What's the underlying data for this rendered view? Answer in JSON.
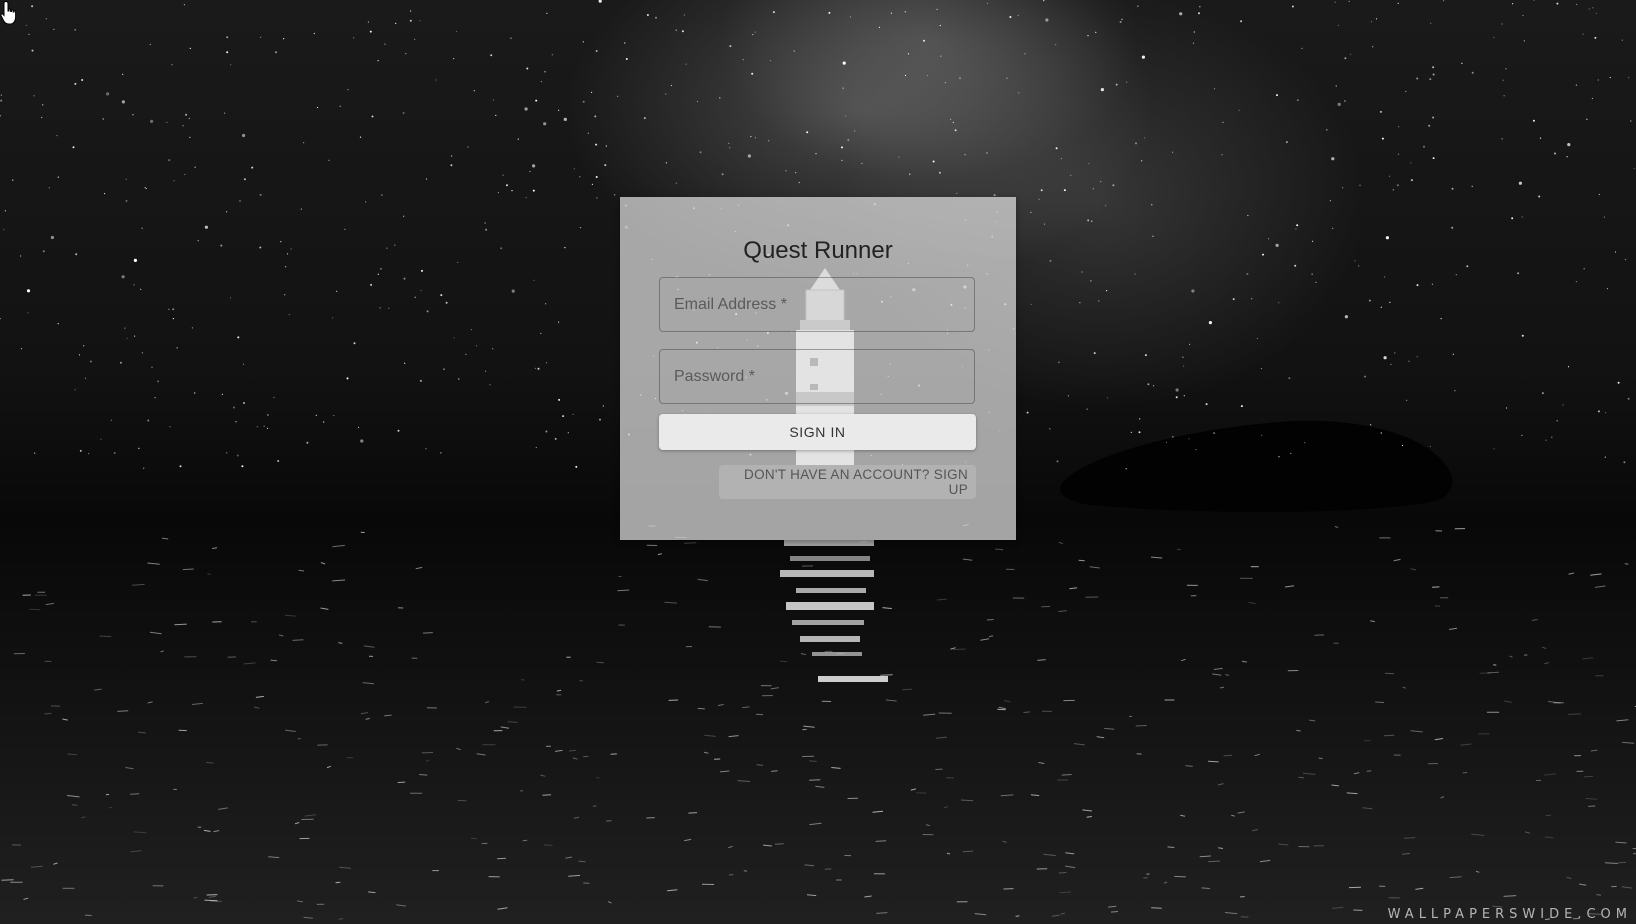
{
  "background": {
    "description_icon": "night-sky-lighthouse-wallpaper",
    "watermark": "WALLPAPERSWIDE.COM"
  },
  "login": {
    "title": "Quest Runner",
    "email_placeholder": "Email Address *",
    "password_placeholder": "Password *",
    "sign_in_label": "SIGN IN",
    "sign_up_label": "DON'T HAVE AN ACCOUNT? SIGN UP"
  },
  "cursor": {
    "icon": "hand-pointer-icon"
  },
  "colors": {
    "card_bg": "#e1e1e1",
    "button_bg": "#eaeaea",
    "text": "#222222"
  }
}
